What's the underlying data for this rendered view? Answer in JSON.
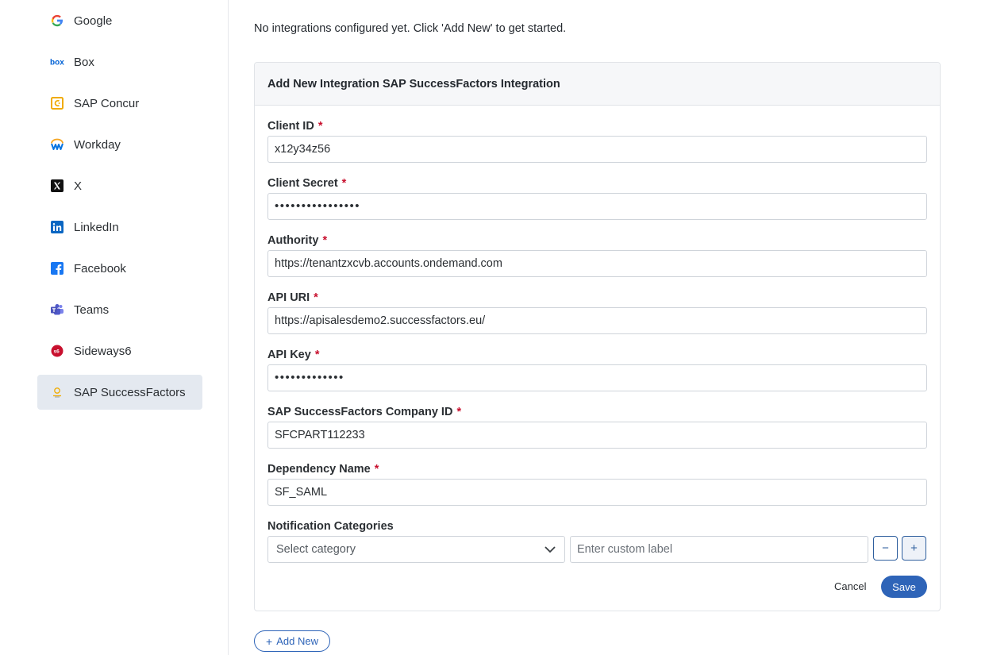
{
  "sidebar": {
    "items": [
      {
        "label": "Google",
        "icon": "google-icon"
      },
      {
        "label": "Box",
        "icon": "box-icon"
      },
      {
        "label": "SAP Concur",
        "icon": "sap-concur-icon"
      },
      {
        "label": "Workday",
        "icon": "workday-icon"
      },
      {
        "label": "X",
        "icon": "x-icon"
      },
      {
        "label": "LinkedIn",
        "icon": "linkedin-icon"
      },
      {
        "label": "Facebook",
        "icon": "facebook-icon"
      },
      {
        "label": "Teams",
        "icon": "teams-icon"
      },
      {
        "label": "Sideways6",
        "icon": "sideways6-icon"
      },
      {
        "label": "SAP SuccessFactors",
        "icon": "sap-successfactors-icon",
        "active": true
      }
    ]
  },
  "main": {
    "intro": "No integrations configured yet. Click 'Add New' to get started.",
    "card_title": "Add New Integration SAP SuccessFactors Integration",
    "fields": {
      "client_id": {
        "label": "Client ID",
        "value": "x12y34z56"
      },
      "client_secret": {
        "label": "Client Secret",
        "value": "••••••••••••••••"
      },
      "authority": {
        "label": "Authority",
        "value": "https://tenantzxcvb.accounts.ondemand.com"
      },
      "api_uri": {
        "label": "API URI",
        "value": "https://apisalesdemo2.successfactors.eu/"
      },
      "api_key": {
        "label": "API Key",
        "value": "•••••••••••••"
      },
      "company_id": {
        "label": "SAP SuccessFactors Company ID",
        "value": "SFCPART112233"
      },
      "dependency_name": {
        "label": "Dependency Name",
        "value": "SF_SAML"
      }
    },
    "required_marker": "*",
    "notification": {
      "label": "Notification Categories",
      "select_placeholder": "Select category",
      "custom_placeholder": "Enter custom label",
      "minus": "−",
      "plus": "+"
    },
    "cancel_label": "Cancel",
    "save_label": "Save",
    "add_new_label": "Add New",
    "add_new_icon": "+"
  },
  "colors": {
    "accent": "#2e64b8",
    "required": "#c8102e",
    "active_bg": "#e4e9f0"
  }
}
